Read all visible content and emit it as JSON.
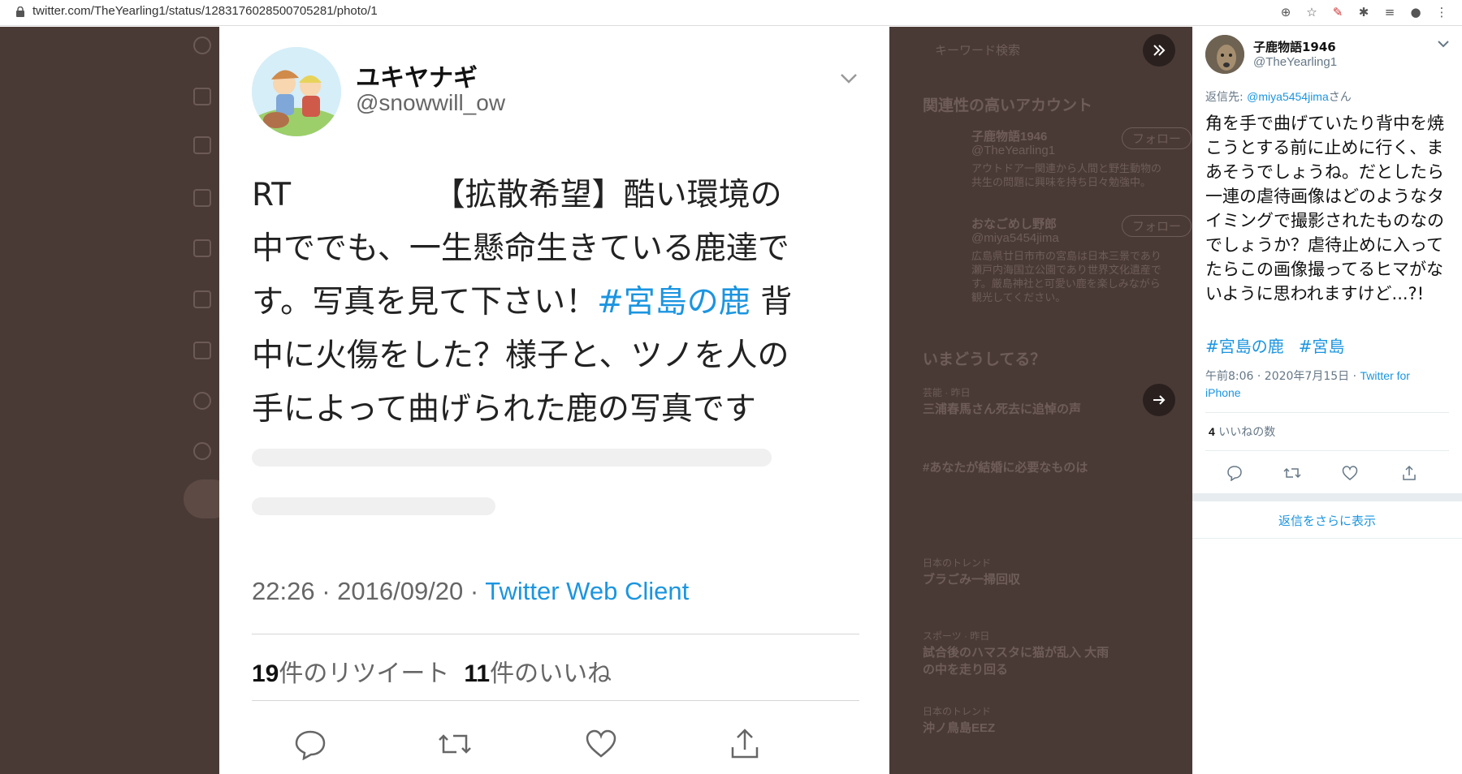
{
  "browser": {
    "url": "twitter.com/TheYearling1/status/1283176028500705281/photo/1",
    "toolbar_icons": [
      "add-icon",
      "star-icon",
      "pdf-icon",
      "puzzle-icon",
      "reading-list-icon",
      "account-icon",
      "menu-icon"
    ]
  },
  "photo_tweet": {
    "display_name": "ユキヤナギ",
    "handle": "@snowwill_ow",
    "text_lines": [
      {
        "prefix": "RT",
        "rest": "　　　　　【拡散希望】酷い環境の"
      },
      {
        "text": "中ででも、一生懸命生きている鹿達で"
      },
      {
        "text": "す。写真を見て下さい！",
        "hashtag": "#宮島の鹿",
        "after": " 背"
      },
      {
        "text": "中に火傷をした？様子と、ツノを人の"
      },
      {
        "text": "手によって曲げられた鹿の写真です"
      }
    ],
    "time": "22:26 · 2016/09/20 · ",
    "client": "Twitter Web Client",
    "retweets": {
      "count": "19",
      "label": "件のリツイート"
    },
    "likes": {
      "count": "11",
      "label": "件のいいね"
    }
  },
  "reply_panel": {
    "display_name": "子鹿物語1946",
    "handle": "@TheYearling1",
    "reply_to_label": "返信先: ",
    "reply_to_handle": "@miya5454jima",
    "reply_to_suffix": "さん",
    "text": "角を手で曲げていたり背中を焼こうとする前に止めに行く、まあそうでしょうね。だとしたら一連の虐待画像はどのようなタイミングで撮影されたものなのでしょうか？虐待止めに入ってたらこの画像撮ってるヒマがないように思われますけど...?!",
    "hashtags": [
      "#宮島の鹿",
      "#宮島"
    ],
    "time": "午前8:06 · 2020年7月15日 · ",
    "client": "Twitter for iPhone",
    "like_count": "4",
    "like_label": " いいねの数",
    "show_more": "返信をさらに表示"
  },
  "background": {
    "search_placeholder": "キーワード検索",
    "related_heading": "関連性の高いアカウント",
    "accounts": [
      {
        "name": "子鹿物語1946",
        "handle": "@TheYearling1",
        "follow": "フォロー",
        "bio": "アウトドア一関連から人間と野生動物の共生の問題に興味を持ち日々勉強中。"
      },
      {
        "name": "おなごめし野郎",
        "handle": "@miya5454jima",
        "follow": "フォロー",
        "bio": "広島県廿日市市の宮島は日本三景であり瀬戸内海国立公園であり世界文化遺産です。厳島神社と可愛い鹿を楽しみながら観光してください。"
      }
    ],
    "trending_heading": "いまどうしてる？",
    "trends": [
      {
        "meta": "芸能 · 昨日",
        "title": "三浦春馬さん死去に追悼の声"
      },
      {
        "meta": "",
        "title": "#あなたが結婚に必要なものは"
      },
      {
        "meta": "日本のトレンド",
        "title": "ブラごみ一掃回収"
      },
      {
        "meta": "スポーツ · 昨日",
        "title": "試合後のハマスタに猫が乱入 大雨の中を走り回る"
      },
      {
        "meta": "日本のトレンド",
        "title": "沖ノ鳥島EEZ"
      }
    ]
  }
}
